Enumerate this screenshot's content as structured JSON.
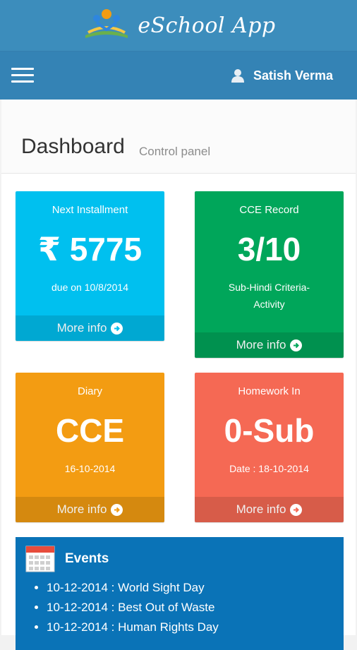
{
  "app": {
    "title": "eSchool App"
  },
  "navbar": {
    "user_name": "Satish Verma"
  },
  "header": {
    "title": "Dashboard",
    "subtitle": "Control panel"
  },
  "boxes": [
    {
      "title": "Next Installment",
      "value": "₹ 5775",
      "sub": "due on 10/8/2014",
      "more": "More info",
      "color": "#00c0ef"
    },
    {
      "title": "CCE Record",
      "value": "3/10",
      "sub1": "Sub-Hindi Criteria-",
      "sub2": "Activity",
      "more": "More info",
      "color": "#00a65a"
    },
    {
      "title": "Diary",
      "value": "CCE",
      "sub": "16-10-2014",
      "more": "More info",
      "color": "#f39c12"
    },
    {
      "title": "Homework In",
      "value": "0-Sub",
      "sub": "Date : 18-10-2014",
      "more": "More info",
      "color": "#f56954"
    }
  ],
  "events": {
    "title": "Events",
    "items": [
      "10-12-2014 : World Sight Day",
      "10-12-2014 : Best Out of Waste",
      "10-12-2014 : Human Rights Day"
    ]
  }
}
